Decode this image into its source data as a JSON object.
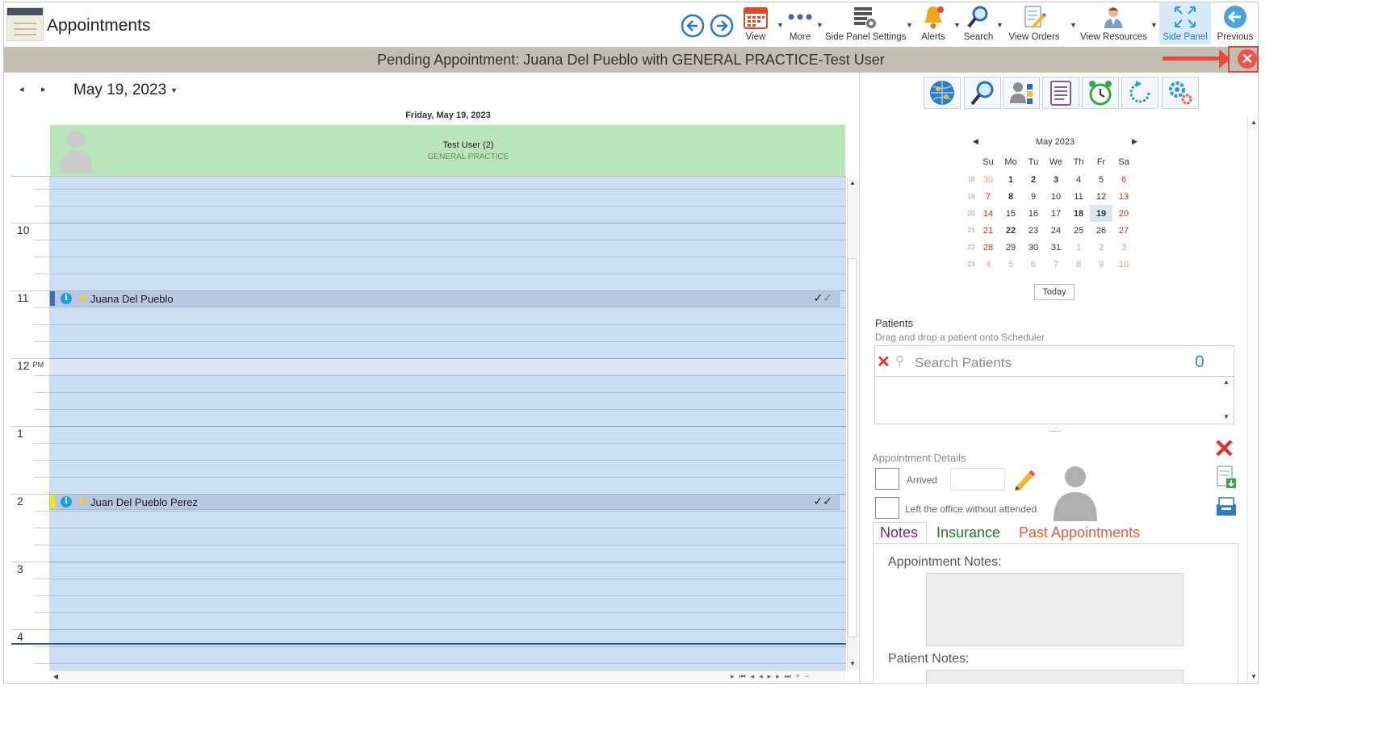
{
  "app": {
    "title": "Appointments"
  },
  "toolbar": {
    "view": "View",
    "more": "More",
    "side_panel_settings": "Side Panel Settings",
    "alerts": "Alerts",
    "search": "Search",
    "view_orders": "View Orders",
    "view_resources": "View Resources",
    "side_panel": "Side Panel",
    "previous": "Previous"
  },
  "pending_bar": {
    "text": "Pending Appointment: Juana Del Pueblo with GENERAL PRACTICE-Test User"
  },
  "scheduler": {
    "date_title": "May 19, 2023",
    "day_header": "Friday, May 19, 2023",
    "resource": {
      "name": "Test User (2)",
      "specialty": "GENERAL PRACTICE"
    },
    "hours": [
      {
        "label": "10",
        "suffix": ""
      },
      {
        "label": "11",
        "suffix": ""
      },
      {
        "label": "12",
        "suffix": "PM"
      },
      {
        "label": "1",
        "suffix": ""
      },
      {
        "label": "2",
        "suffix": ""
      },
      {
        "label": "3",
        "suffix": ""
      },
      {
        "label": "4",
        "suffix": ""
      }
    ],
    "appointments": [
      {
        "name": "Juana Del Pueblo",
        "stripe_color": "#3f6fb4",
        "checks": [
          "✓",
          "✓"
        ],
        "check_colors": [
          "#222222",
          "#3aa546"
        ]
      },
      {
        "name": "Juan Del Pueblo Perez",
        "stripe_color": "#f1e21a",
        "checks": [
          "✓",
          "✓"
        ],
        "check_colors": [
          "#222222",
          "#222222"
        ]
      }
    ]
  },
  "side_panel": {
    "icons": [
      "globe-icon",
      "magnifier-icon",
      "contact-card-icon",
      "clipboard-icon",
      "alarm-clock-icon",
      "refresh-icon",
      "gears-icon"
    ],
    "calendar": {
      "month_label": "May 2023",
      "weekdays": [
        "Su",
        "Mo",
        "Tu",
        "We",
        "Th",
        "Fr",
        "Sa"
      ],
      "weeks": [
        {
          "wk": "18",
          "days": [
            "30",
            "1",
            "2",
            "3",
            "4",
            "5",
            "6"
          ]
        },
        {
          "wk": "19",
          "days": [
            "7",
            "8",
            "9",
            "10",
            "11",
            "12",
            "13"
          ]
        },
        {
          "wk": "20",
          "days": [
            "14",
            "15",
            "16",
            "17",
            "18",
            "19",
            "20"
          ]
        },
        {
          "wk": "21",
          "days": [
            "21",
            "22",
            "23",
            "24",
            "25",
            "26",
            "27"
          ]
        },
        {
          "wk": "22",
          "days": [
            "28",
            "29",
            "30",
            "31",
            "1",
            "2",
            "3"
          ]
        },
        {
          "wk": "23",
          "days": [
            "4",
            "5",
            "6",
            "7",
            "8",
            "9",
            "10"
          ]
        }
      ],
      "selected_day": "19",
      "today_label": "Today"
    },
    "patients": {
      "title": "Patients",
      "subtitle": "Drag and drop a patient onto Scheduler",
      "search_placeholder": "Search Patients",
      "count": "0"
    },
    "appointment_details": {
      "title": "Appointment Details",
      "arrived_label": "Arrived",
      "left_label": "Left the office without attended"
    },
    "tabs": [
      {
        "label": "Notes",
        "color": "#7a1f86"
      },
      {
        "label": "Insurance",
        "color": "#1e7a2e"
      },
      {
        "label": "Past Appointments",
        "color": "#ef5a3a"
      }
    ],
    "notes": {
      "appointment_notes_label": "Appointment Notes:",
      "patient_notes_label": "Patient Notes:"
    }
  }
}
